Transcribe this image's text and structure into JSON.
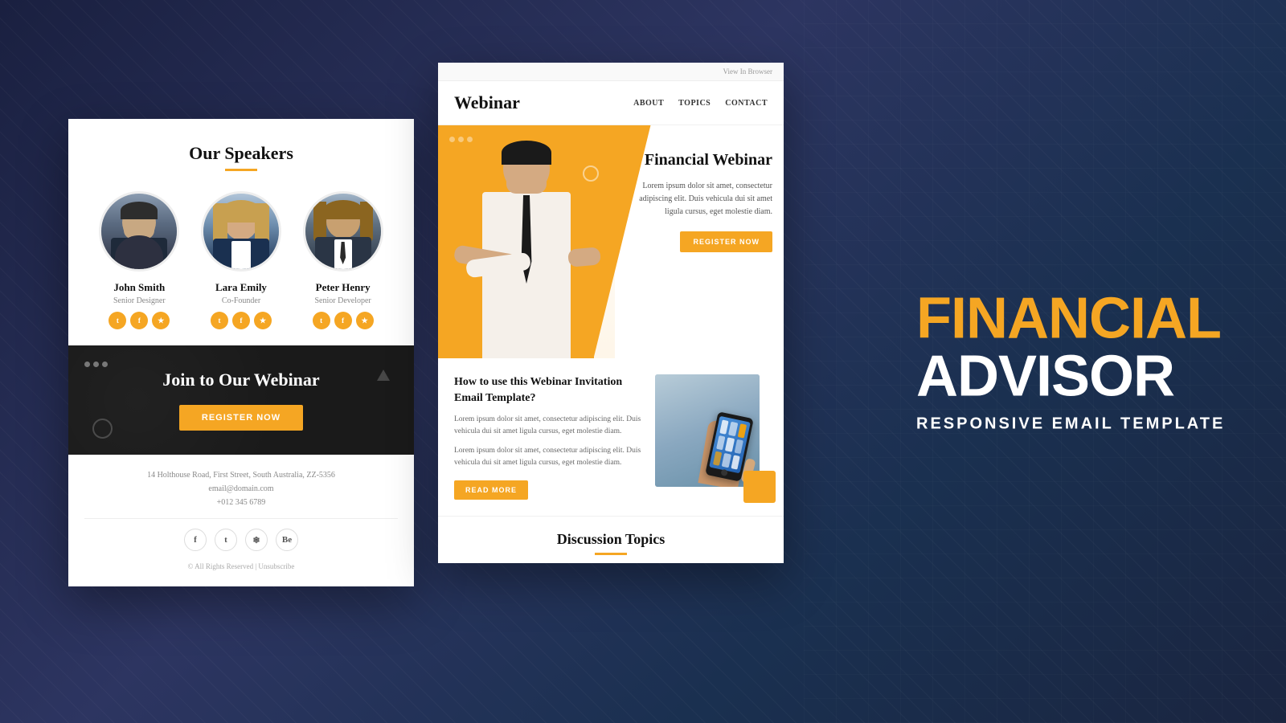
{
  "background": {
    "color": "#2d3561"
  },
  "brand": {
    "line1": "FINANCIAL",
    "line2": "ADVISOR",
    "subtitle": "RESPONSIVE EMAIL TEMPLATE"
  },
  "email_left": {
    "top_bar": "",
    "speakers_section": {
      "title": "Our Speakers",
      "speakers": [
        {
          "name": "John Smith",
          "role": "Senior Designer",
          "socials": [
            "t",
            "f",
            "i"
          ]
        },
        {
          "name": "Lara Emily",
          "role": "Co-Founder",
          "socials": [
            "t",
            "f",
            "i"
          ]
        },
        {
          "name": "Peter Henry",
          "role": "Senior Developer",
          "socials": [
            "t",
            "f",
            "i"
          ]
        }
      ]
    },
    "dark_section": {
      "title": "Join to Our Webinar",
      "button_label": "REGISTER NOW"
    },
    "footer": {
      "address": "14 Holthouse Road, First Street, South Australia, ZZ-5356",
      "email": "email@domain.com",
      "phone": "+012 345 6789",
      "copyright": "© All Rights Reserved | Unsubscribe"
    }
  },
  "email_right": {
    "top_bar": "View In Browser",
    "header": {
      "logo": "Webinar",
      "nav": [
        "ABOUT",
        "TOPICS",
        "CONTACT"
      ]
    },
    "hero": {
      "title": "Financial Webinar",
      "description": "Lorem ipsum dolor sit amet, consectetur adipiscing elit. Duis vehicula dui sit amet ligula cursus, eget molestie diam.",
      "button_label": "REGISTER NOW"
    },
    "article": {
      "title": "How to use this Webinar Invitation Email Template?",
      "body1": "Lorem ipsum dolor sit amet, consectetur adipiscing elit. Duis vehicula dui sit amet ligula cursus, eget molestie diam.",
      "body2": "Lorem ipsum dolor sit amet, consectetur adipiscing elit. Duis vehicula dui sit amet ligula cursus, eget molestie diam.",
      "button_label": "READ MORE"
    },
    "discussion": {
      "title": "Discussion Topics"
    }
  }
}
